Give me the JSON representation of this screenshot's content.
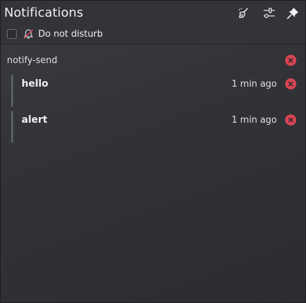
{
  "header": {
    "title": "Notifications",
    "buttons": [
      {
        "name": "clear-all",
        "icon": "broom-icon"
      },
      {
        "name": "configure",
        "icon": "sliders-icon"
      },
      {
        "name": "pin",
        "icon": "pin-icon"
      }
    ]
  },
  "dnd": {
    "label": "Do not disturb",
    "checked": false,
    "icon": "bell-off-icon"
  },
  "group": {
    "app_name": "notify-send",
    "close_icon": "close-circle-icon"
  },
  "notifications": [
    {
      "title": "hello",
      "time": "1 min ago"
    },
    {
      "title": "alert",
      "time": "1 min ago"
    }
  ],
  "colors": {
    "close_red": "#da4453",
    "text": "#eff0f1",
    "bar": "#5b5e63"
  }
}
